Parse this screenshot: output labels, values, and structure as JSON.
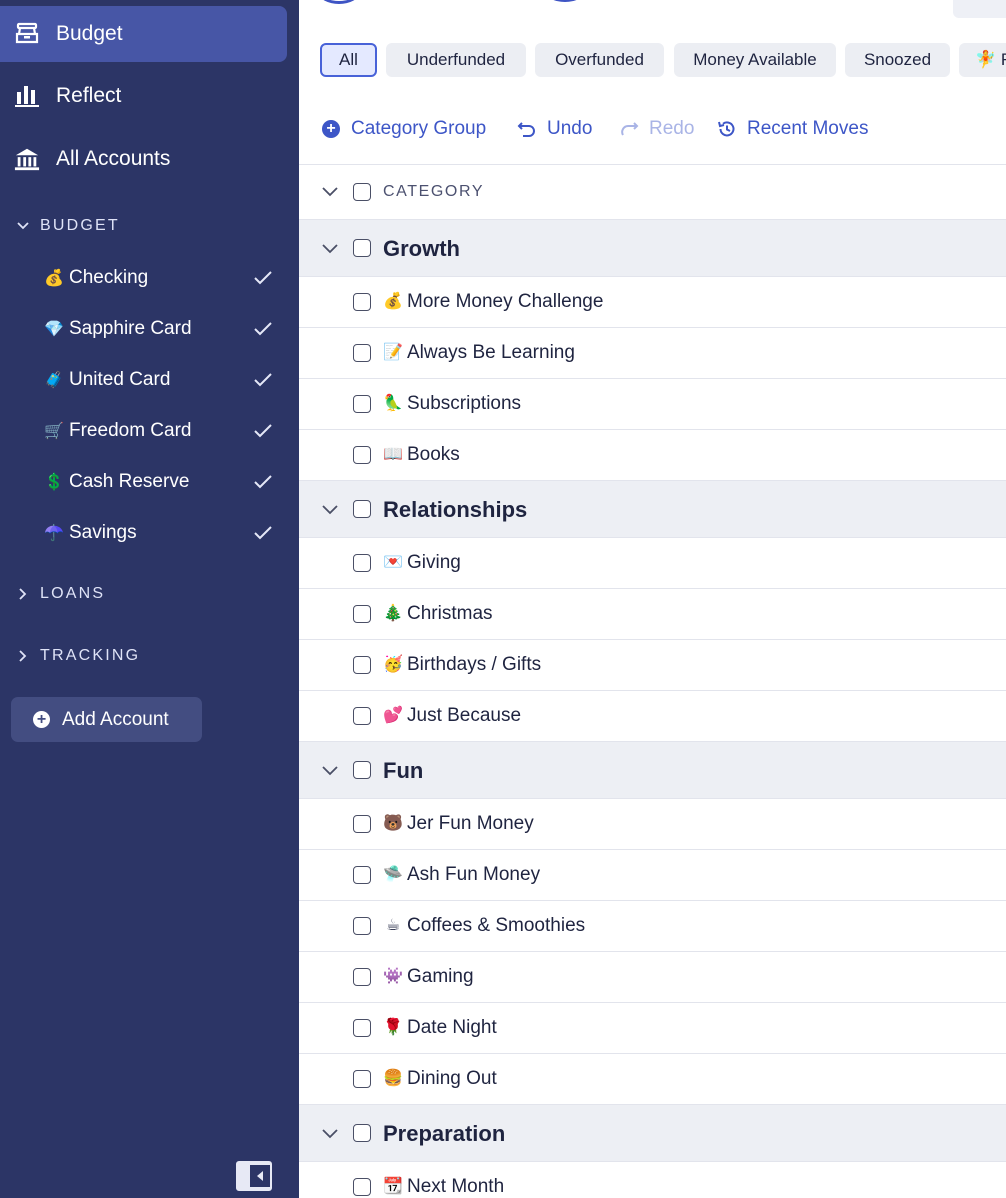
{
  "sidebar": {
    "nav": [
      {
        "label": "Budget",
        "icon": "budget-icon",
        "active": true
      },
      {
        "label": "Reflect",
        "icon": "bar-chart-icon",
        "active": false
      },
      {
        "label": "All Accounts",
        "icon": "bank-icon",
        "active": false
      }
    ],
    "sections": {
      "budget": "BUDGET",
      "loans": "LOANS",
      "tracking": "TRACKING"
    },
    "accounts": [
      {
        "emoji": "💰",
        "name": "Checking",
        "reconciled": true
      },
      {
        "emoji": "💎",
        "name": "Sapphire Card",
        "reconciled": true
      },
      {
        "emoji": "🧳",
        "name": "United Card",
        "reconciled": true
      },
      {
        "emoji": "🛒",
        "name": "Freedom Card",
        "reconciled": true
      },
      {
        "emoji": "💲",
        "name": "Cash Reserve",
        "reconciled": true
      },
      {
        "emoji": "☂️",
        "name": "Savings",
        "reconciled": true
      }
    ],
    "add_account": "Add Account"
  },
  "filters": [
    {
      "label": "All",
      "active": true
    },
    {
      "label": "Underfunded",
      "active": false
    },
    {
      "label": "Overfunded",
      "active": false
    },
    {
      "label": "Money Available",
      "active": false
    },
    {
      "label": "Snoozed",
      "active": false
    },
    {
      "label": "🧚 R",
      "active": false
    }
  ],
  "toolbar": {
    "category_group": "Category Group",
    "undo": "Undo",
    "redo": "Redo",
    "recent_moves": "Recent Moves"
  },
  "table": {
    "header": "CATEGORY",
    "groups": [
      {
        "name": "Growth",
        "categories": [
          {
            "emoji": "💰",
            "name": "More Money Challenge"
          },
          {
            "emoji": "📝",
            "name": "Always Be Learning"
          },
          {
            "emoji": "🦜",
            "name": "Subscriptions"
          },
          {
            "emoji": "📖",
            "name": "Books"
          }
        ]
      },
      {
        "name": "Relationships",
        "categories": [
          {
            "emoji": "💌",
            "name": "Giving"
          },
          {
            "emoji": "🎄",
            "name": "Christmas"
          },
          {
            "emoji": "🥳",
            "name": "Birthdays / Gifts"
          },
          {
            "emoji": "💕",
            "name": "Just Because"
          }
        ]
      },
      {
        "name": "Fun",
        "categories": [
          {
            "emoji": "🐻",
            "name": "Jer Fun Money"
          },
          {
            "emoji": "🛸",
            "name": "Ash Fun Money"
          },
          {
            "emoji": "☕",
            "name": "Coffees & Smoothies"
          },
          {
            "emoji": "👾",
            "name": "Gaming"
          },
          {
            "emoji": "🌹",
            "name": "Date Night"
          },
          {
            "emoji": "🍔",
            "name": "Dining Out"
          }
        ]
      },
      {
        "name": "Preparation",
        "categories": [
          {
            "emoji": "📆",
            "name": "Next Month"
          }
        ]
      }
    ]
  },
  "colors": {
    "sidebar_bg": "#2c3566",
    "sidebar_active": "#4756a6",
    "accent": "#3d56c7",
    "group_row_bg": "#edeff4"
  }
}
